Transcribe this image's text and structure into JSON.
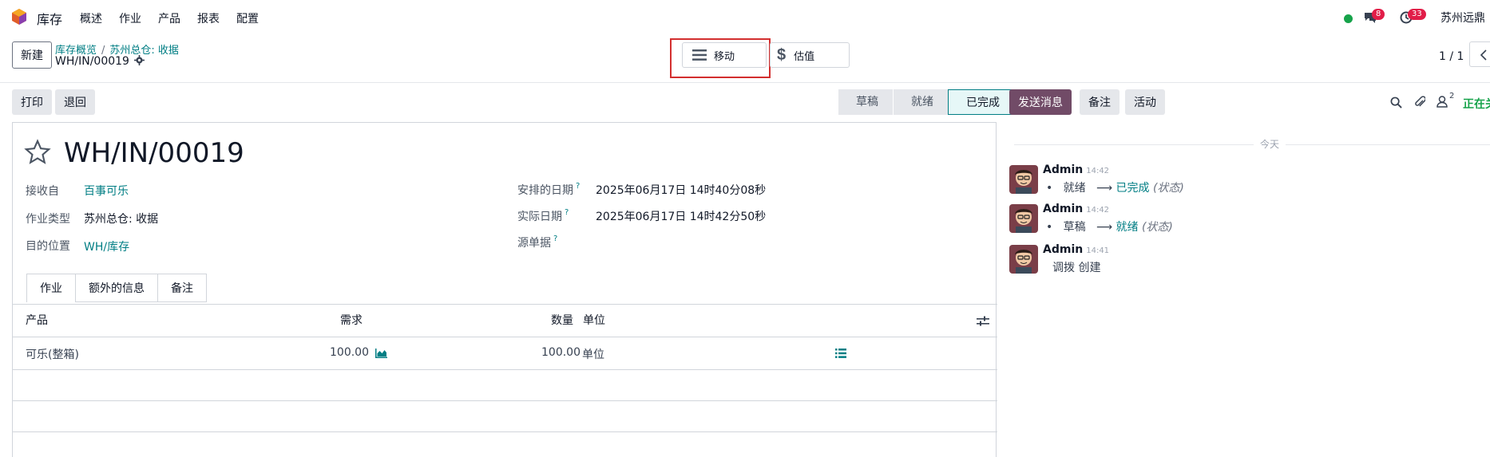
{
  "topbar": {
    "app_name": "库存",
    "menu": [
      "概述",
      "作业",
      "产品",
      "报表",
      "配置"
    ],
    "chat_badge": "8",
    "activity_badge": "33",
    "company": "苏州远鼎"
  },
  "control": {
    "new_label": "新建",
    "breadcrumb": [
      "库存概览",
      "苏州总仓: 收据"
    ],
    "record_name": "WH/IN/00019",
    "smart_move": "移动",
    "smart_valuation": "估值",
    "pager": "1 / 1"
  },
  "actions": {
    "print": "打印",
    "return": "退回"
  },
  "status": {
    "stages": [
      "草稿",
      "就绪",
      "已完成"
    ],
    "active": "已完成"
  },
  "form": {
    "title": "WH/IN/00019",
    "fields_left": [
      {
        "label": "接收自",
        "value": "百事可乐"
      },
      {
        "label": "作业类型",
        "value": "苏州总仓: 收据"
      },
      {
        "label": "目的位置",
        "value": "WH/库存"
      }
    ],
    "fields_right": [
      {
        "label": "安排的日期",
        "value": "2025年06月17日 14时40分08秒"
      },
      {
        "label": "实际日期",
        "value": "2025年06月17日 14时42分50秒"
      },
      {
        "label": "源单据",
        "value": ""
      }
    ],
    "tabs": [
      "作业",
      "额外的信息",
      "备注"
    ],
    "table": {
      "headers": {
        "product": "产品",
        "demand": "需求",
        "quantity": "数量",
        "uom": "单位"
      },
      "rows": [
        {
          "product": "可乐(整箱)",
          "demand": "100.00",
          "quantity": "100.00",
          "uom": "单位"
        }
      ]
    }
  },
  "chatter": {
    "send_message": "发送消息",
    "log_note": "备注",
    "activity": "活动",
    "followers_count": "2",
    "following": "正在关",
    "today": "今天",
    "messages": [
      {
        "author": "Admin",
        "time": "14:42",
        "old": "就绪",
        "new": "已完成",
        "field": "(状态)"
      },
      {
        "author": "Admin",
        "time": "14:42",
        "old": "草稿",
        "new": "就绪",
        "field": "(状态)"
      },
      {
        "author": "Admin",
        "time": "14:41",
        "text": "调拨 创建"
      }
    ]
  },
  "colors": {
    "brand": "#714b67",
    "link": "#017e84",
    "highlight_border": "#d32f2f"
  }
}
